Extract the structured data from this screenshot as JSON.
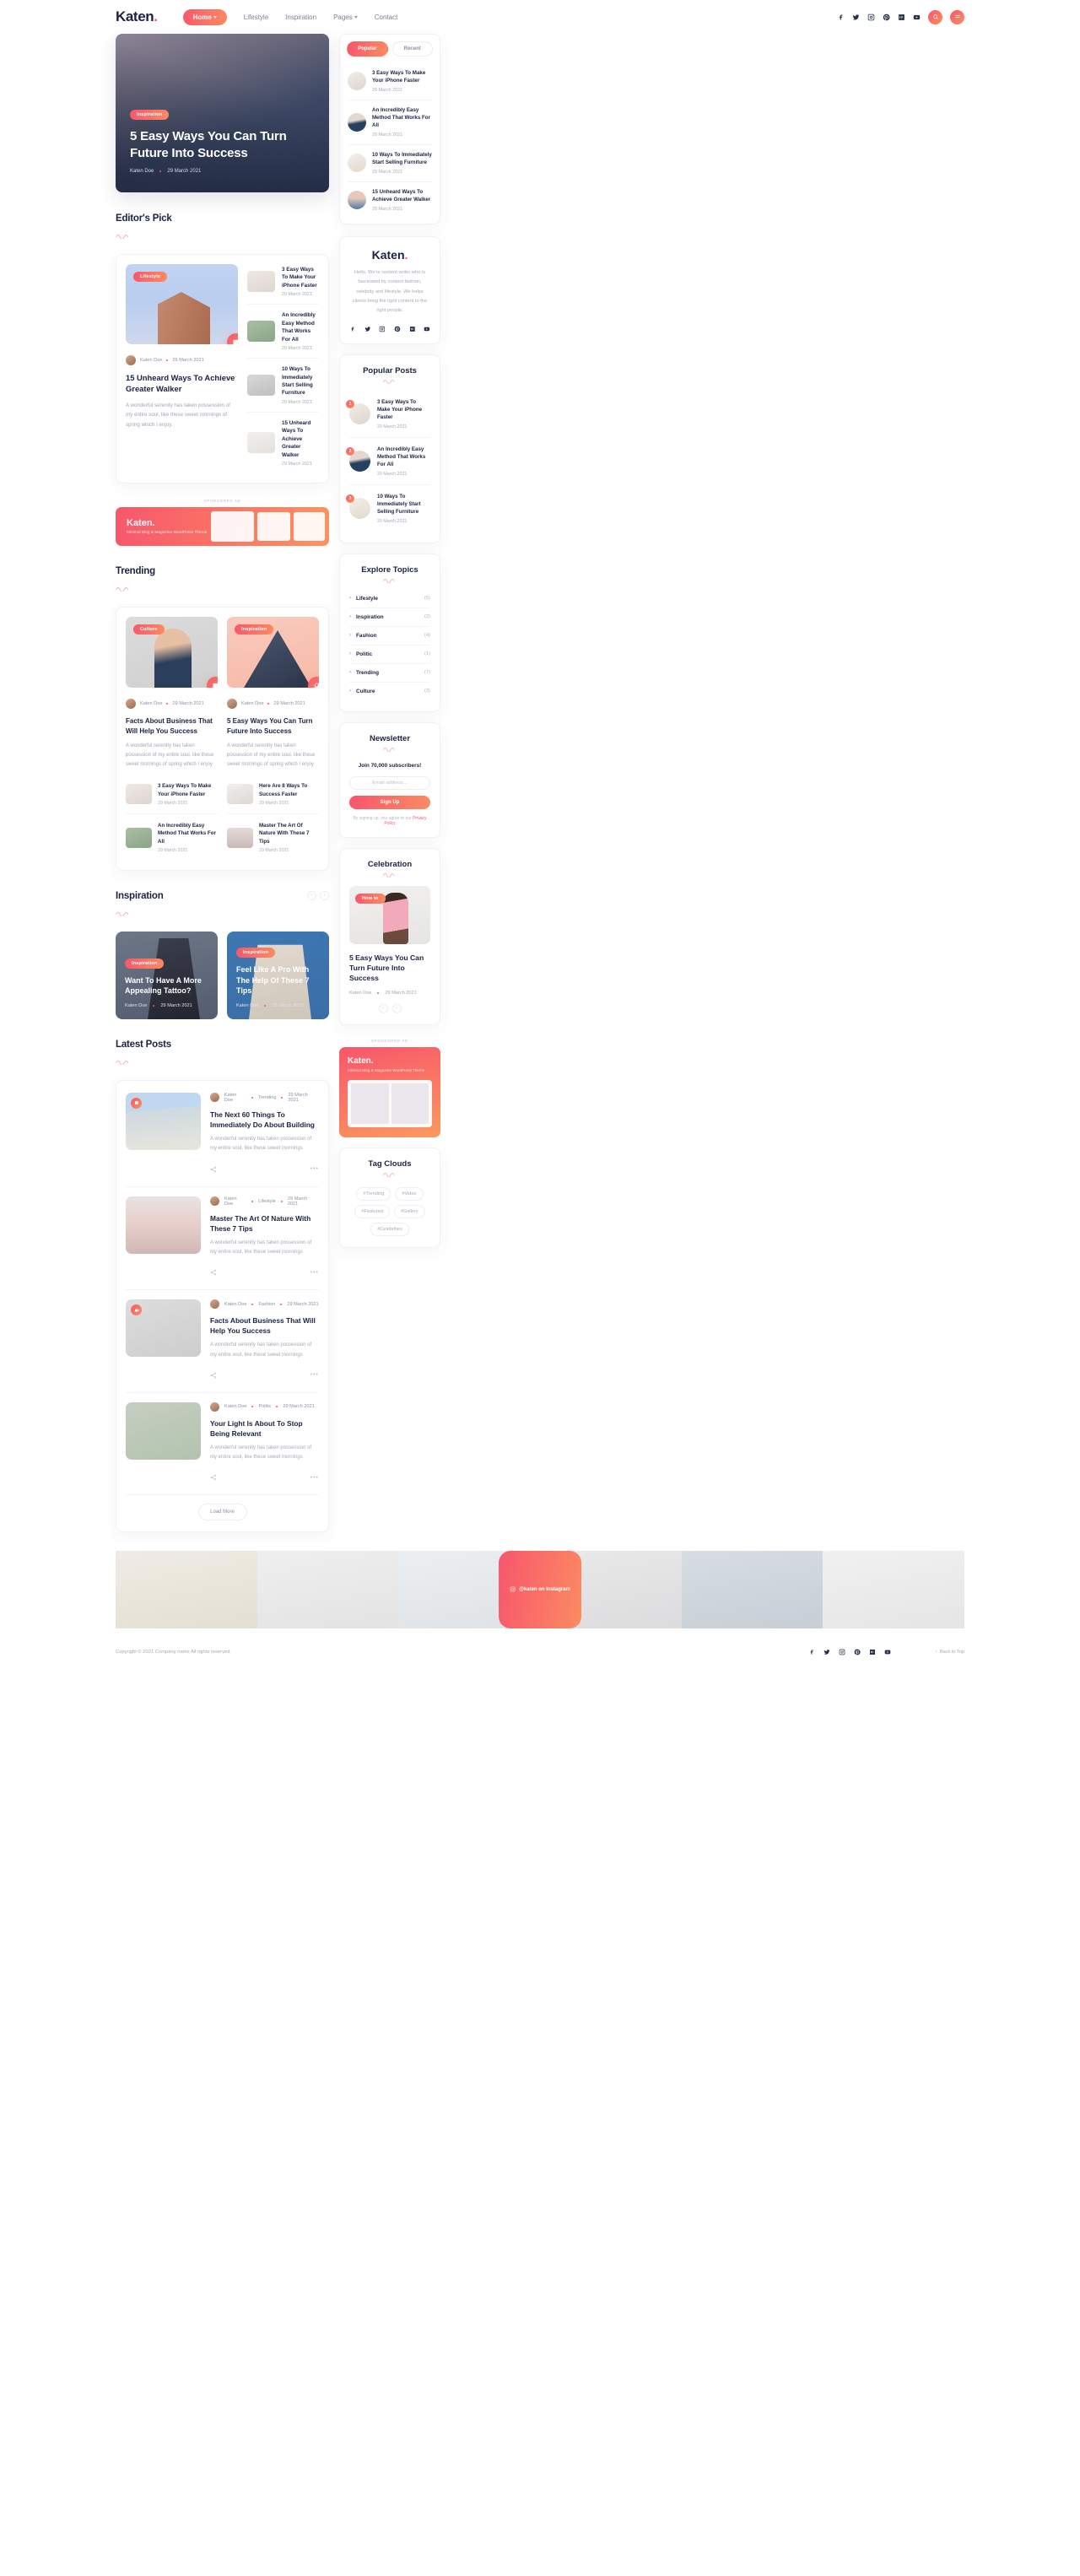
{
  "header": {
    "logo": "Katen",
    "logo_dot": ".",
    "nav": [
      {
        "label": "Home",
        "active": true,
        "caret": true
      },
      {
        "label": "Lifestyle",
        "active": false,
        "caret": false
      },
      {
        "label": "Inspiration",
        "active": false,
        "caret": false
      },
      {
        "label": "Pages",
        "active": false,
        "caret": true
      },
      {
        "label": "Contact",
        "active": false,
        "caret": false
      }
    ],
    "socials": [
      "facebook-icon",
      "twitter-icon",
      "instagram-icon",
      "pinterest-icon",
      "medium-icon",
      "youtube-icon"
    ],
    "search_icon": "search-icon",
    "menu_icon": "menu-icon"
  },
  "hero": {
    "badge": "Inspiration",
    "title": "5 Easy Ways You Can Turn Future Into Success",
    "author": "Katen Doe",
    "date": "29 March 2021"
  },
  "popular_tabs": {
    "tabs": [
      {
        "label": "Popular",
        "active": true
      },
      {
        "label": "Recent",
        "active": false
      }
    ],
    "items": [
      {
        "title": "3 Easy Ways To Make Your iPhone Faster",
        "date": "29 March 2021"
      },
      {
        "title": "An Incredibly Easy Method That Works For All",
        "date": "29 March 2021"
      },
      {
        "title": "10 Ways To Immediately Start Selling Furniture",
        "date": "29 March 2021"
      },
      {
        "title": "15 Unheard Ways To Achieve Greater Walker",
        "date": "29 March 2021"
      }
    ]
  },
  "editors_pick": {
    "title": "Editor's Pick",
    "feature": {
      "badge": "Lifestyle",
      "author": "Katen Doe",
      "date": "29 March 2021",
      "title": "15 Unheard Ways To Achieve Greater Walker",
      "excerpt": "A wonderful serenity has taken possession of my entire soul, like these sweet mornings of spring which I enjoy.",
      "format_icon": "image-icon"
    },
    "list": [
      {
        "title": "3 Easy Ways To Make Your iPhone Faster",
        "date": "29 March 2021"
      },
      {
        "title": "An Incredibly Easy Method That Works For All",
        "date": "29 March 2021"
      },
      {
        "title": "10 Ways To Immediately Start Selling Furniture",
        "date": "29 March 2021"
      },
      {
        "title": "15 Unheard Ways To Achieve Greater Walker",
        "date": "29 March 2021"
      }
    ]
  },
  "sponsored_label": "- SPONSORED AD -",
  "ad_banner": {
    "title": "Katen",
    "dot": ".",
    "subtitle": "Minimal Blog & Magazine WordPress Theme"
  },
  "trending": {
    "title": "Trending",
    "cards": [
      {
        "badge": "Culture",
        "author": "Katen Doe",
        "date": "29 March 2021",
        "title": "Facts About Business That Will Help You Success",
        "excerpt": "A wonderful serenity has taken possession of my entire soul, like these sweet mornings of spring which I enjoy",
        "format_icon": "image-icon"
      },
      {
        "badge": "Inspiration",
        "author": "Katen Doe",
        "date": "29 March 2021",
        "title": "5 Easy Ways You Can Turn Future Into Success",
        "excerpt": "A wonderful serenity has taken possession of my entire soul, like these sweet mornings of spring which I enjoy",
        "format_icon": "headphones-icon"
      }
    ],
    "small_left": [
      {
        "title": "3 Easy Ways To Make Your iPhone Faster",
        "date": "29 March 2021"
      },
      {
        "title": "An Incredibly Easy Method That Works For All",
        "date": "29 March 2021"
      }
    ],
    "small_right": [
      {
        "title": "Here Are 8 Ways To Success Faster",
        "date": "29 March 2021"
      },
      {
        "title": "Master The Art Of Nature With These 7 Tips",
        "date": "29 March 2021"
      }
    ]
  },
  "inspiration": {
    "title": "Inspiration",
    "prev": "‹",
    "next": "›",
    "cards": [
      {
        "badge": "Inspiration",
        "title": "Want To Have A More Appealing Tattoo?",
        "author": "Katen Doe",
        "date": "29 March 2021"
      },
      {
        "badge": "Inspiration",
        "title": "Feel Like A Pro With The Help Of These 7 Tips",
        "author": "Katen Doe",
        "date": "29 March 2021"
      }
    ]
  },
  "latest_posts": {
    "title": "Latest Posts",
    "load_more": "Load More",
    "items": [
      {
        "author": "Katen Doe",
        "category": "Trending",
        "date": "29 March 2021",
        "title": "The Next 60 Things To Immediately Do About Building",
        "excerpt": "A wonderful serenity has taken possession of my entire soul, like these sweet mornings",
        "format_icon": "image-icon",
        "has_format_badge": true
      },
      {
        "author": "Katen Doe",
        "category": "Lifestyle",
        "date": "29 March 2021",
        "title": "Master The Art Of Nature With These 7 Tips",
        "excerpt": "A wonderful serenity has taken possession of my entire soul, like these sweet mornings",
        "format_icon": "",
        "has_format_badge": false
      },
      {
        "author": "Katen Doe",
        "category": "Fashion",
        "date": "29 March 2021",
        "title": "Facts About Business That Will Help You Success",
        "excerpt": "A wonderful serenity has taken possession of my entire soul, like these sweet mornings",
        "format_icon": "video-icon",
        "has_format_badge": true
      },
      {
        "author": "Katen Doe",
        "category": "Politic",
        "date": "29 March 2021",
        "title": "Your Light Is About To Stop Being Relevant",
        "excerpt": "A wonderful serenity has taken possession of my entire soul, like these sweet mornings",
        "format_icon": "",
        "has_format_badge": false
      }
    ]
  },
  "sidebar": {
    "about": {
      "logo": "Katen",
      "dot": ".",
      "text": "Hello, We're content writer who is fascinated by content fashion, celebrity and lifestyle. We helps clients bring the right content to the right people.",
      "socials": [
        "facebook-icon",
        "twitter-icon",
        "instagram-icon",
        "pinterest-icon",
        "medium-icon",
        "youtube-icon"
      ]
    },
    "popular_posts": {
      "title": "Popular Posts",
      "items": [
        {
          "num": "1",
          "title": "3 Easy Ways To Make Your iPhone Faster",
          "date": "29 March 2021"
        },
        {
          "num": "2",
          "title": "An Incredibly Easy Method That Works For All",
          "date": "29 March 2021"
        },
        {
          "num": "3",
          "title": "10 Ways To Immediately Start Selling Furniture",
          "date": "29 March 2021"
        }
      ]
    },
    "explore_topics": {
      "title": "Explore Topics",
      "items": [
        {
          "label": "Lifestyle",
          "count": "(5)"
        },
        {
          "label": "Inspiration",
          "count": "(2)"
        },
        {
          "label": "Fashion",
          "count": "(4)"
        },
        {
          "label": "Politic",
          "count": "(1)"
        },
        {
          "label": "Trending",
          "count": "(7)"
        },
        {
          "label": "Culture",
          "count": "(3)"
        }
      ]
    },
    "newsletter": {
      "title": "Newsletter",
      "subtitle": "Join 70,000 subscribers!",
      "placeholder": "Email address...",
      "button": "Sign Up",
      "note_pre": "By signing up, you agree to our ",
      "note_link": "Privacy Policy"
    },
    "celebration": {
      "title": "Celebration",
      "badge": "How to",
      "post_title": "5 Easy Ways You Can Turn Future Into Success",
      "author": "Katen Doe",
      "date": "29 March 2021",
      "prev": "‹",
      "next": "›"
    },
    "side_ad": {
      "sponsored_label": "- SPONSORED AD -",
      "title": "Katen",
      "dot": ".",
      "subtitle": "Minimal Blog & Magazine WordPress Theme"
    },
    "tag_clouds": {
      "title": "Tag Clouds",
      "tags": [
        "#Trending",
        "#Video",
        "#Featured",
        "#Gallery",
        "#Celebrities"
      ]
    }
  },
  "instagram": {
    "button": "@katen on Instagram",
    "icon": "instagram-icon"
  },
  "footer": {
    "copyright": "Copyright © 2021 Company name All rights reserved.",
    "socials": [
      "facebook-icon",
      "twitter-icon",
      "instagram-icon",
      "pinterest-icon",
      "medium-icon",
      "youtube-icon"
    ],
    "back_to_top": "Back to Top"
  },
  "colors": {
    "accent_start": "#f8566c",
    "accent_end": "#fb9460",
    "ink": "#1b2141",
    "muted": "#a6aaba"
  }
}
